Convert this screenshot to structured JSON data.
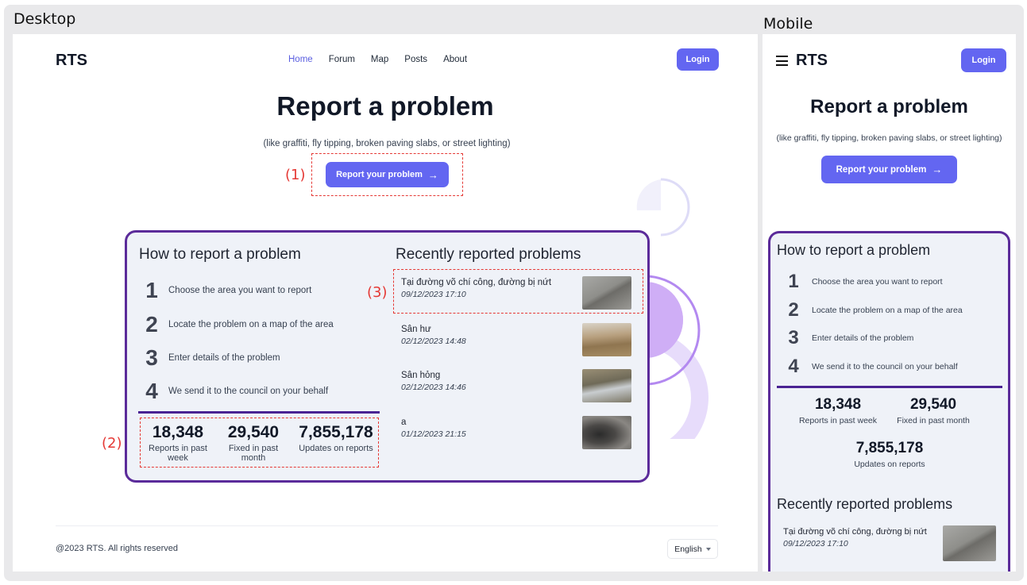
{
  "labels": {
    "desktop": "Desktop",
    "mobile": "Mobile"
  },
  "brand": "RTS",
  "nav": [
    "Home",
    "Forum",
    "Map",
    "Posts",
    "About"
  ],
  "login": "Login",
  "hero": {
    "title": "Report a problem",
    "subtitle": "(like graffiti, fly tipping, broken paving slabs, or street lighting)",
    "cta": "Report your problem"
  },
  "annotations": {
    "cta": "(1)",
    "stats": "(2)",
    "recent": "(3)"
  },
  "how": {
    "title": "How to report a problem",
    "steps": [
      {
        "num": "1",
        "text": "Choose the area you want to report"
      },
      {
        "num": "2",
        "text": "Locate the problem on a map of the area"
      },
      {
        "num": "3",
        "text": "Enter details of the problem"
      },
      {
        "num": "4",
        "text": "We send it to the council on your behalf"
      }
    ]
  },
  "stats": {
    "desktop": [
      {
        "value": "18,348",
        "label": "Reports in past week"
      },
      {
        "value": "29,540",
        "label": "Fixed in past month"
      },
      {
        "value": "7,855,178",
        "label": "Updates on reports"
      }
    ],
    "mobile": [
      {
        "value": "18,348",
        "label": "Reports in past week"
      },
      {
        "value": "29,540",
        "label": "Fixed in past month"
      },
      {
        "value": "7,855,178",
        "label": "Updates on reports"
      }
    ]
  },
  "recent": {
    "title": "Recently reported problems",
    "items": [
      {
        "title": "Tại đường võ chí công, đường bị nứt",
        "date": "09/12/2023 17:10"
      },
      {
        "title": "Sân hư",
        "date": "02/12/2023 14:48"
      },
      {
        "title": "Sân hỏng",
        "date": "02/12/2023 14:46"
      },
      {
        "title": "a",
        "date": "01/12/2023 21:15"
      }
    ]
  },
  "footer": {
    "copyright": "@2023 RTS. All rights reserved",
    "language": "English"
  },
  "colors": {
    "primary": "#6366f1",
    "card_border": "#5b2b9a",
    "card_bg": "#eff2f8",
    "annotation": "#e53935"
  }
}
